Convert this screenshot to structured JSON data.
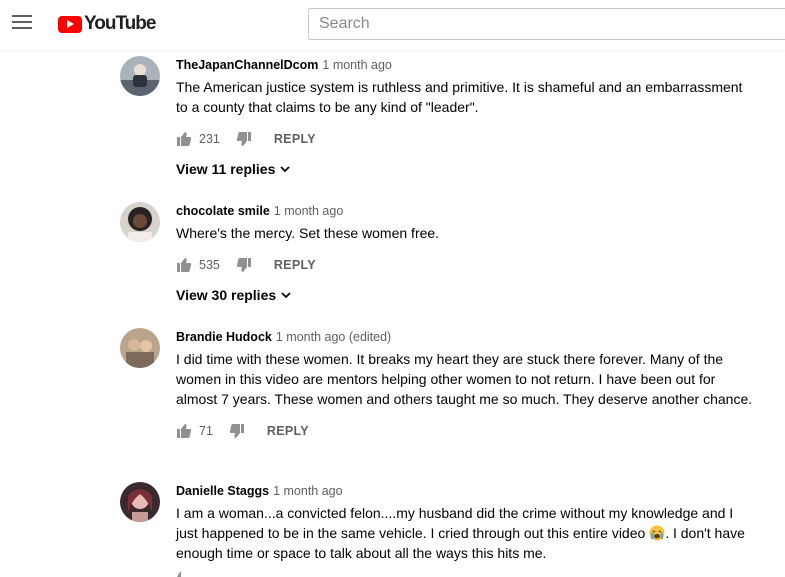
{
  "header": {
    "logo_text": "YouTube",
    "ghost_text": "",
    "search_placeholder": "Search"
  },
  "comments": [
    {
      "author": "TheJapanChannelDcom",
      "time": "1 month ago",
      "text": "The American justice system is ruthless and primitive. It is shameful and an embarrassment to a county that claims to be any kind of \"leader\".",
      "likes": "231",
      "reply_label": "REPLY",
      "replies_label": "View 11 replies"
    },
    {
      "author": "chocolate smile",
      "time": "1 month ago",
      "text": "Where's the mercy.  Set these women free.",
      "likes": "535",
      "reply_label": "REPLY",
      "replies_label": "View 30 replies"
    },
    {
      "author": "Brandie Hudock",
      "time": "1 month ago (edited)",
      "text": "I did time with these women. It breaks my heart they are stuck there forever. Many of the women in this video are mentors helping other women to not return. I have been out for almost 7 years. These women and others taught me so much. They deserve another chance.",
      "likes": "71",
      "reply_label": "REPLY"
    },
    {
      "author": "Danielle Staggs",
      "time": "1 month ago",
      "text_before": "I am a woman...a convicted felon....my husband did the crime without my knowledge and I just happened to be in the same vehicle. I cried through out this entire video ",
      "emoji": "crying-face-emoji",
      "text_after": ". I don't have enough time or space to talk about all the ways this hits me."
    }
  ],
  "colors": {
    "brand_red": "#ff0000",
    "text_primary": "#030303",
    "text_secondary": "#606060"
  }
}
